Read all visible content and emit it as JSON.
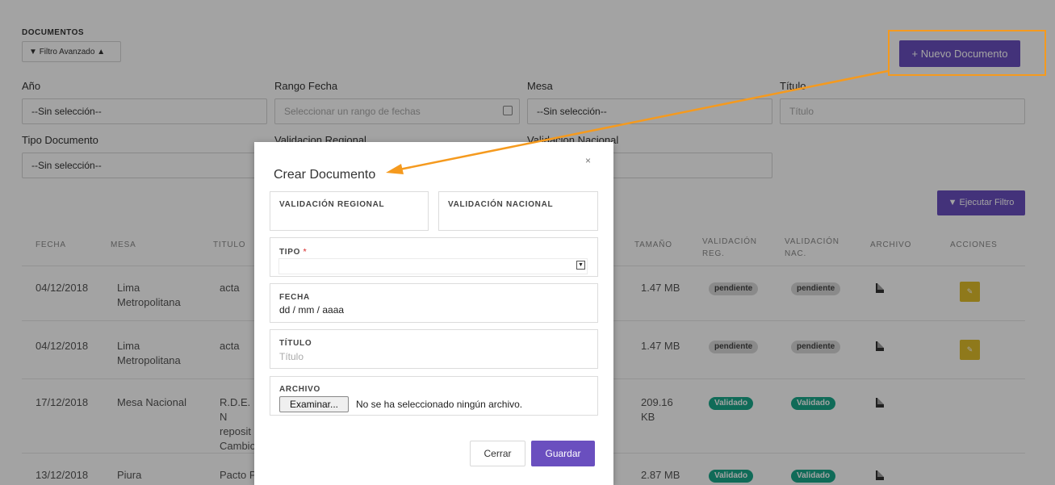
{
  "header": {
    "section_title": "DOCUMENTOS",
    "filter_toggle_label": "Filtro Avanzado",
    "new_document_label": "Nuevo Documento"
  },
  "filters": {
    "year": {
      "label": "Año",
      "value": "--Sin selección--"
    },
    "date_range": {
      "label": "Rango Fecha",
      "placeholder": "Seleccionar un rango de fechas"
    },
    "table": {
      "label": "Mesa",
      "value": "--Sin selección--"
    },
    "title": {
      "label": "Título",
      "placeholder": "Título"
    },
    "doc_type": {
      "label": "Tipo Documento",
      "value": "--Sin selección--"
    },
    "regional_validation": {
      "label": "Validacion Regional"
    },
    "national_validation": {
      "label": "Validacion Nacional"
    },
    "run_filter_label": "Ejecutar Filtro"
  },
  "table": {
    "headers": [
      "FECHA",
      "MESA",
      "TITULO",
      "TAMAÑO",
      "VALIDACIÓN REG.",
      "VALIDACIÓN NAC.",
      "ARCHIVO",
      "ACCIONES"
    ],
    "rows": [
      {
        "fecha": "04/12/2018",
        "mesa": "Lima Metropolitana",
        "titulo": "acta",
        "tamano": "1.47 MB",
        "val_reg": "pendiente",
        "val_nac": "pendiente",
        "editable": true
      },
      {
        "fecha": "04/12/2018",
        "mesa": "Lima Metropolitana",
        "titulo": "acta",
        "tamano": "1.47 MB",
        "val_reg": "pendiente",
        "val_nac": "pendiente",
        "editable": true
      },
      {
        "fecha": "17/12/2018",
        "mesa": "Mesa Nacional",
        "titulo": "R.D.E. N reposit Cambio",
        "tamano": "209.16 KB",
        "val_reg": "Validado",
        "val_nac": "Validado",
        "editable": false
      },
      {
        "fecha": "13/12/2018",
        "mesa": "Piura",
        "titulo": "Pacto P",
        "tamano": "2.87 MB",
        "val_reg": "Validado",
        "val_nac": "Validado",
        "editable": false
      }
    ]
  },
  "modal": {
    "title": "Crear Documento",
    "close_glyph": "×",
    "regional_label": "VALIDACIÓN REGIONAL",
    "national_label": "VALIDACIÓN NACIONAL",
    "type_label": "TIPO",
    "required_mark": "*",
    "date_label": "FECHA",
    "date_value": "dd / mm / aaaa",
    "title_label": "TÍTULO",
    "title_placeholder": "Título",
    "file_label": "ARCHIVO",
    "browse_label": "Examinar...",
    "no_file_text": "No se ha seleccionado ningún archivo.",
    "cancel_label": "Cerrar",
    "save_label": "Guardar"
  },
  "colors": {
    "primary": "#6a4fbf",
    "highlight": "#f59a1e",
    "validated": "#1aa88a",
    "pending": "#d8d8d8",
    "edit": "#e0bd2b"
  },
  "icons": [
    "filter-icon",
    "caret-up-icon",
    "plus-icon",
    "calendar-icon",
    "file-icon",
    "edit-icon",
    "close-icon",
    "select-arrow-icon"
  ]
}
